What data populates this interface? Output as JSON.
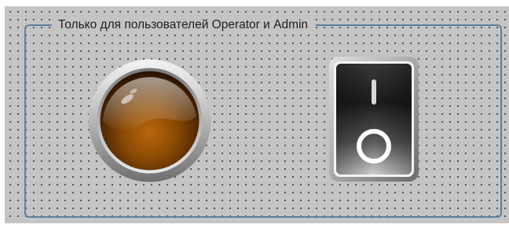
{
  "panel": {
    "title": "Только для пользователей Operator и Admin"
  },
  "indicator_lamp": {
    "icon": "round-indicator-lamp-icon",
    "color": "#8a4a05",
    "state": "off"
  },
  "rocker_switch": {
    "icon": "rocker-switch-icon",
    "state": "off"
  },
  "colors": {
    "background": "#c4c4c4",
    "group_border": "#5f7f9a"
  }
}
